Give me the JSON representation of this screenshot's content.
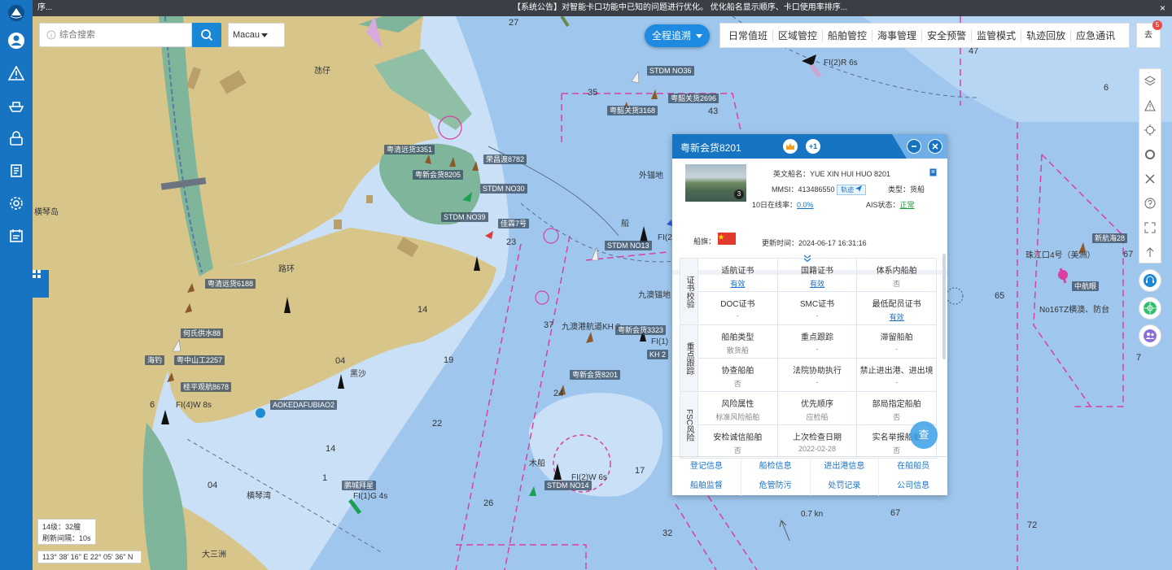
{
  "topbar": {
    "left_text": "序...",
    "announcement": "【系统公告】对智能卡口功能中已知的问题进行优化。 优化船名显示顺序、卡口使用率排序...",
    "close": "×"
  },
  "search": {
    "placeholder": "综合搜索"
  },
  "region": {
    "selected": "Macau"
  },
  "track_button": {
    "label": "全程追溯"
  },
  "menu": {
    "items": [
      "日常值班",
      "区域管控",
      "船舶管控",
      "海事管理",
      "安全预警",
      "监管模式",
      "轨迹回放",
      "应急通讯"
    ]
  },
  "notification": {
    "label": "去",
    "count": "5"
  },
  "map_info": {
    "level": "14级：32艘",
    "refresh": "刷新间隔：10s",
    "coord": "113° 38' 16\" E  22° 05' 36\" N"
  },
  "vessel_labels": [
    "粤清远货3351",
    "粤新会货8205",
    "荣昌渡8782",
    "STDM NO30",
    "STDM NO39",
    "佳霖7号",
    "STDM NO36",
    "粤韶关货3168",
    "粤韶关货2696",
    "STDM NO13",
    "九澳港航道KH 2",
    "粤新会货3323",
    "KH 2",
    "粤新会货8201",
    "粤清远货6188",
    "何氏供水88",
    "海钓",
    "粤中山工2257",
    "桂平观航8678",
    "AOKEDAFUBIAO2",
    "鹏城拜星",
    "STDM NO14",
    "珠江口4号（美洲）",
    "新航海28",
    "中航眼"
  ],
  "map_text": [
    "氹仔",
    "横琴岛",
    "路环",
    "外锚地",
    "黑沙",
    "九澳锚地",
    "横琴湾",
    "大三洲",
    "木船",
    "船",
    "FI(2)R 6s",
    "FI(4)W 8s",
    "FI(1)G 4s",
    "FI(2)W 6s",
    "FI(1)",
    "FI(2",
    "No16TZ横澳、防台",
    "0.7 kn"
  ],
  "depths": [
    "27",
    "47",
    "35",
    "43",
    "6",
    "23",
    "14",
    "19",
    "04",
    "37",
    "24",
    "65",
    "67",
    "7",
    "22",
    "14",
    "04",
    "17",
    "26",
    "67",
    "32",
    "72",
    "6",
    "1"
  ],
  "popup": {
    "title": "粤新会货8201",
    "plus": "+1",
    "photo_count": "3",
    "english_name_label": "英文船名：",
    "english_name": "YUE XIN HUI HUO 8201",
    "mmsi_label": "MMSI：",
    "mmsi": "413486550",
    "track_chip": "轨迹",
    "type_label": "类型：",
    "type": "货船",
    "online_label": "10日在线率：",
    "online": "0.0%",
    "ais_label": "AIS状态：",
    "ais": "正常",
    "flag_label": "船旗：",
    "update_label": "更新时间：",
    "update": "2024-06-17 16:31:16",
    "groups": [
      {
        "cat": "证书校验",
        "rows": [
          [
            {
              "label": "适航证书",
              "value": "有效",
              "link": true
            },
            {
              "label": "国籍证书",
              "value": "有效",
              "link": true
            },
            {
              "label": "体系内船舶",
              "value": "否",
              "link": false
            }
          ],
          [
            {
              "label": "DOC证书",
              "value": "-",
              "link": false
            },
            {
              "label": "SMC证书",
              "value": "-",
              "link": false
            },
            {
              "label": "最低配员证书",
              "value": "有效",
              "link": true
            }
          ]
        ]
      },
      {
        "cat": "重点跟踪",
        "rows": [
          [
            {
              "label": "船舶类型",
              "value": "散货船",
              "link": false
            },
            {
              "label": "重点跟踪",
              "value": "-",
              "link": false
            },
            {
              "label": "滞留船舶",
              "value": "-",
              "link": false
            }
          ],
          [
            {
              "label": "协查船舶",
              "value": "否",
              "link": false
            },
            {
              "label": "法院协助执行",
              "value": "-",
              "link": false
            },
            {
              "label": "禁止进出港、进出境",
              "value": "-",
              "link": false
            }
          ]
        ]
      },
      {
        "cat": "FSC风险",
        "rows": [
          [
            {
              "label": "风险属性",
              "value": "标准风险船舶",
              "link": false
            },
            {
              "label": "优先顺序",
              "value": "应检船",
              "link": false
            },
            {
              "label": "部局指定船舶",
              "value": "否",
              "link": false
            }
          ],
          [
            {
              "label": "安检诚信船舶",
              "value": "否",
              "link": false
            },
            {
              "label": "上次检查日期",
              "value": "2022-02-28",
              "link": false
            },
            {
              "label": "实名举报船舶",
              "value": "否",
              "link": false
            }
          ]
        ]
      }
    ],
    "footer": [
      [
        "登记信息",
        "船检信息",
        "进出港信息",
        "在船船员"
      ],
      [
        "船舶监督",
        "危管防污",
        "处罚记录",
        "公司信息"
      ]
    ],
    "check_button": "查"
  },
  "colors": {
    "sea": "#9fc7ee",
    "shallow": "#c9e0f7",
    "land": "#d8c58a",
    "green": "#7fb59a",
    "brand": "#1774c3",
    "route": "#d9409f"
  }
}
